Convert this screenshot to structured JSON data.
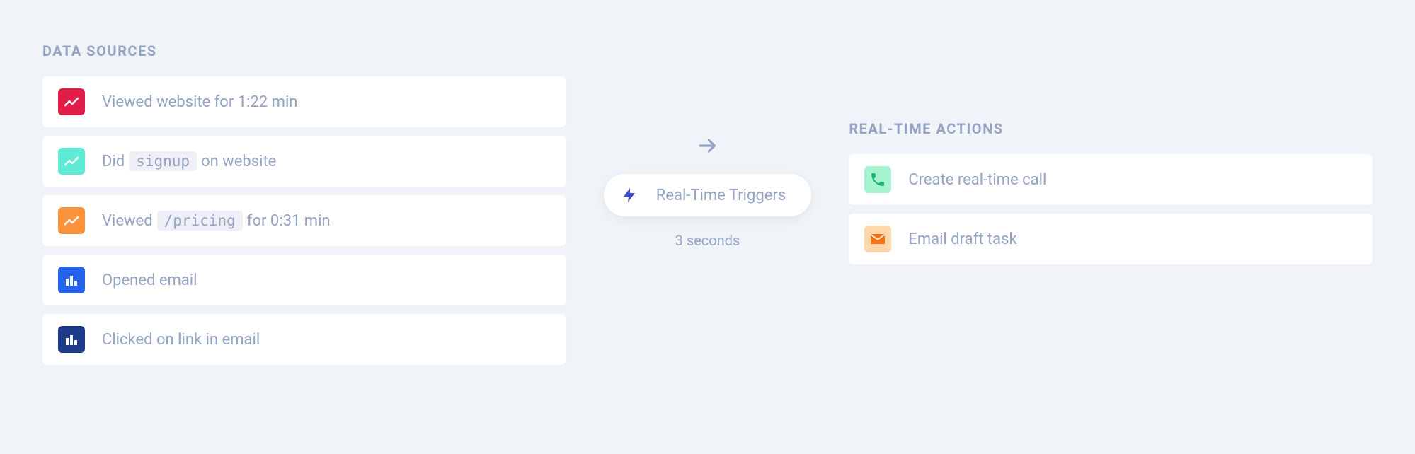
{
  "left": {
    "title": "DATA SOURCES",
    "items": [
      {
        "icon": "chart-line",
        "iconBg": "bg-red",
        "parts": [
          {
            "t": "text",
            "v": "Viewed website for 1:22 min"
          }
        ]
      },
      {
        "icon": "chart-line",
        "iconBg": "bg-teal",
        "parts": [
          {
            "t": "text",
            "v": "Did"
          },
          {
            "t": "code",
            "v": "signup"
          },
          {
            "t": "text",
            "v": "on website"
          }
        ]
      },
      {
        "icon": "chart-line",
        "iconBg": "bg-orange",
        "parts": [
          {
            "t": "text",
            "v": "Viewed"
          },
          {
            "t": "code",
            "v": "/pricing"
          },
          {
            "t": "text",
            "v": "for 0:31 min"
          }
        ]
      },
      {
        "icon": "bar-chart",
        "iconBg": "bg-blue",
        "parts": [
          {
            "t": "text",
            "v": "Opened email"
          }
        ]
      },
      {
        "icon": "bar-chart",
        "iconBg": "bg-navy",
        "parts": [
          {
            "t": "text",
            "v": "Clicked on link in email"
          }
        ]
      }
    ]
  },
  "middle": {
    "pill_label": "Real-Time Triggers",
    "subtext": "3 seconds"
  },
  "right": {
    "title": "REAL-TIME ACTIONS",
    "items": [
      {
        "icon": "phone",
        "iconBg": "bg-mint",
        "iconColor": "#10b981",
        "label": "Create real-time call"
      },
      {
        "icon": "mail",
        "iconBg": "bg-peach",
        "iconColor": "#f97316",
        "label": "Email draft task"
      }
    ]
  }
}
